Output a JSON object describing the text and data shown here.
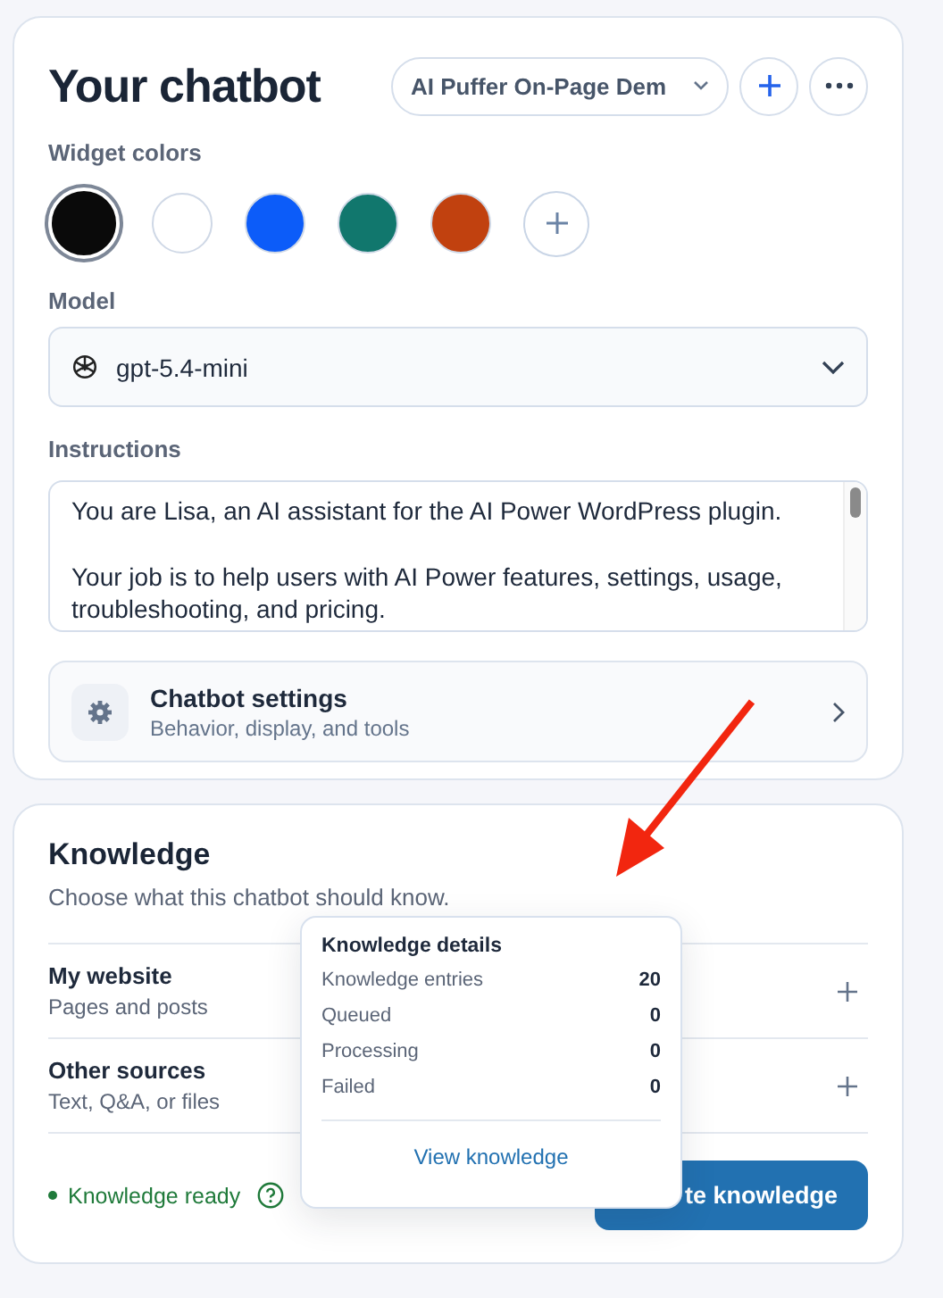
{
  "chatbot": {
    "title": "Your chatbot",
    "bot_select": "AI Puffer On-Page Dem",
    "colors_label": "Widget colors",
    "colors": [
      {
        "color": "#0a0a0a",
        "selected": true
      },
      {
        "color": "#ffffff",
        "selected": false
      },
      {
        "color": "#0c5cf9",
        "selected": false
      },
      {
        "color": "#11776d",
        "selected": false
      },
      {
        "color": "#c1410f",
        "selected": false
      }
    ],
    "model_label": "Model",
    "model": "gpt-5.4-mini",
    "instructions_label": "Instructions",
    "instructions": [
      "You are Lisa, an AI assistant for the AI Power WordPress plugin.",
      "Your job is to help users with AI Power features, settings, usage, troubleshooting, and pricing."
    ],
    "settings": {
      "title": "Chatbot settings",
      "subtitle": "Behavior, display, and tools"
    }
  },
  "knowledge": {
    "title": "Knowledge",
    "subtitle": "Choose what this chatbot should know.",
    "sources": [
      {
        "title": "My website",
        "subtitle": "Pages and posts"
      },
      {
        "title": "Other sources",
        "subtitle": "Text, Q&A, or files"
      }
    ],
    "status": "Knowledge ready",
    "button": "te knowledge"
  },
  "popover": {
    "title": "Knowledge details",
    "rows": [
      {
        "label": "Knowledge entries",
        "value": "20"
      },
      {
        "label": "Queued",
        "value": "0"
      },
      {
        "label": "Processing",
        "value": "0"
      },
      {
        "label": "Failed",
        "value": "0"
      }
    ],
    "link": "View knowledge"
  }
}
